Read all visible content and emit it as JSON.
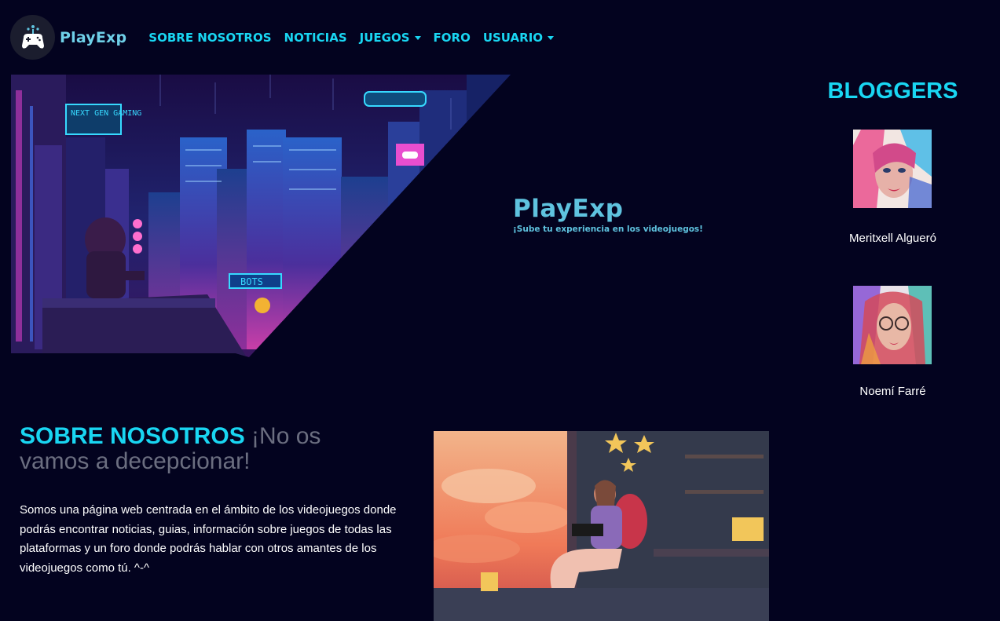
{
  "brand": {
    "name": "PlayExp",
    "logo_icon": "gamepad-icon"
  },
  "nav": {
    "items": [
      {
        "label": "SOBRE NOSOTROS",
        "dropdown": false
      },
      {
        "label": "NOTICIAS",
        "dropdown": false
      },
      {
        "label": "JUEGOS",
        "dropdown": true
      },
      {
        "label": "FORO",
        "dropdown": false
      },
      {
        "label": "USUARIO",
        "dropdown": true
      }
    ]
  },
  "hero": {
    "logo_title": "PlayExp",
    "logo_slogan": "¡Sube tu experiencia en los videojuegos!",
    "signs": [
      "NEXT GEN GAMING",
      "BOTS"
    ]
  },
  "bloggers": {
    "title": "BLOGGERS",
    "people": [
      {
        "name": "Meritxell Algueró"
      },
      {
        "name": "Noemí Farré"
      }
    ]
  },
  "about": {
    "heading_strong": "SOBRE NOSOTROS",
    "heading_muted": "¡No os vamos a decepcionar!",
    "text": "Somos una página web centrada en el ámbito de los videojuegos donde podrás encontrar noticias, guias, información sobre juegos de todas las plataformas y un foro donde podrás hablar con otros amantes de los videojuegos como tú. ^-^"
  },
  "colors": {
    "background": "#03031f",
    "accent": "#19d6f2",
    "brand": "#6fd0e8",
    "muted": "#6b6e80"
  }
}
